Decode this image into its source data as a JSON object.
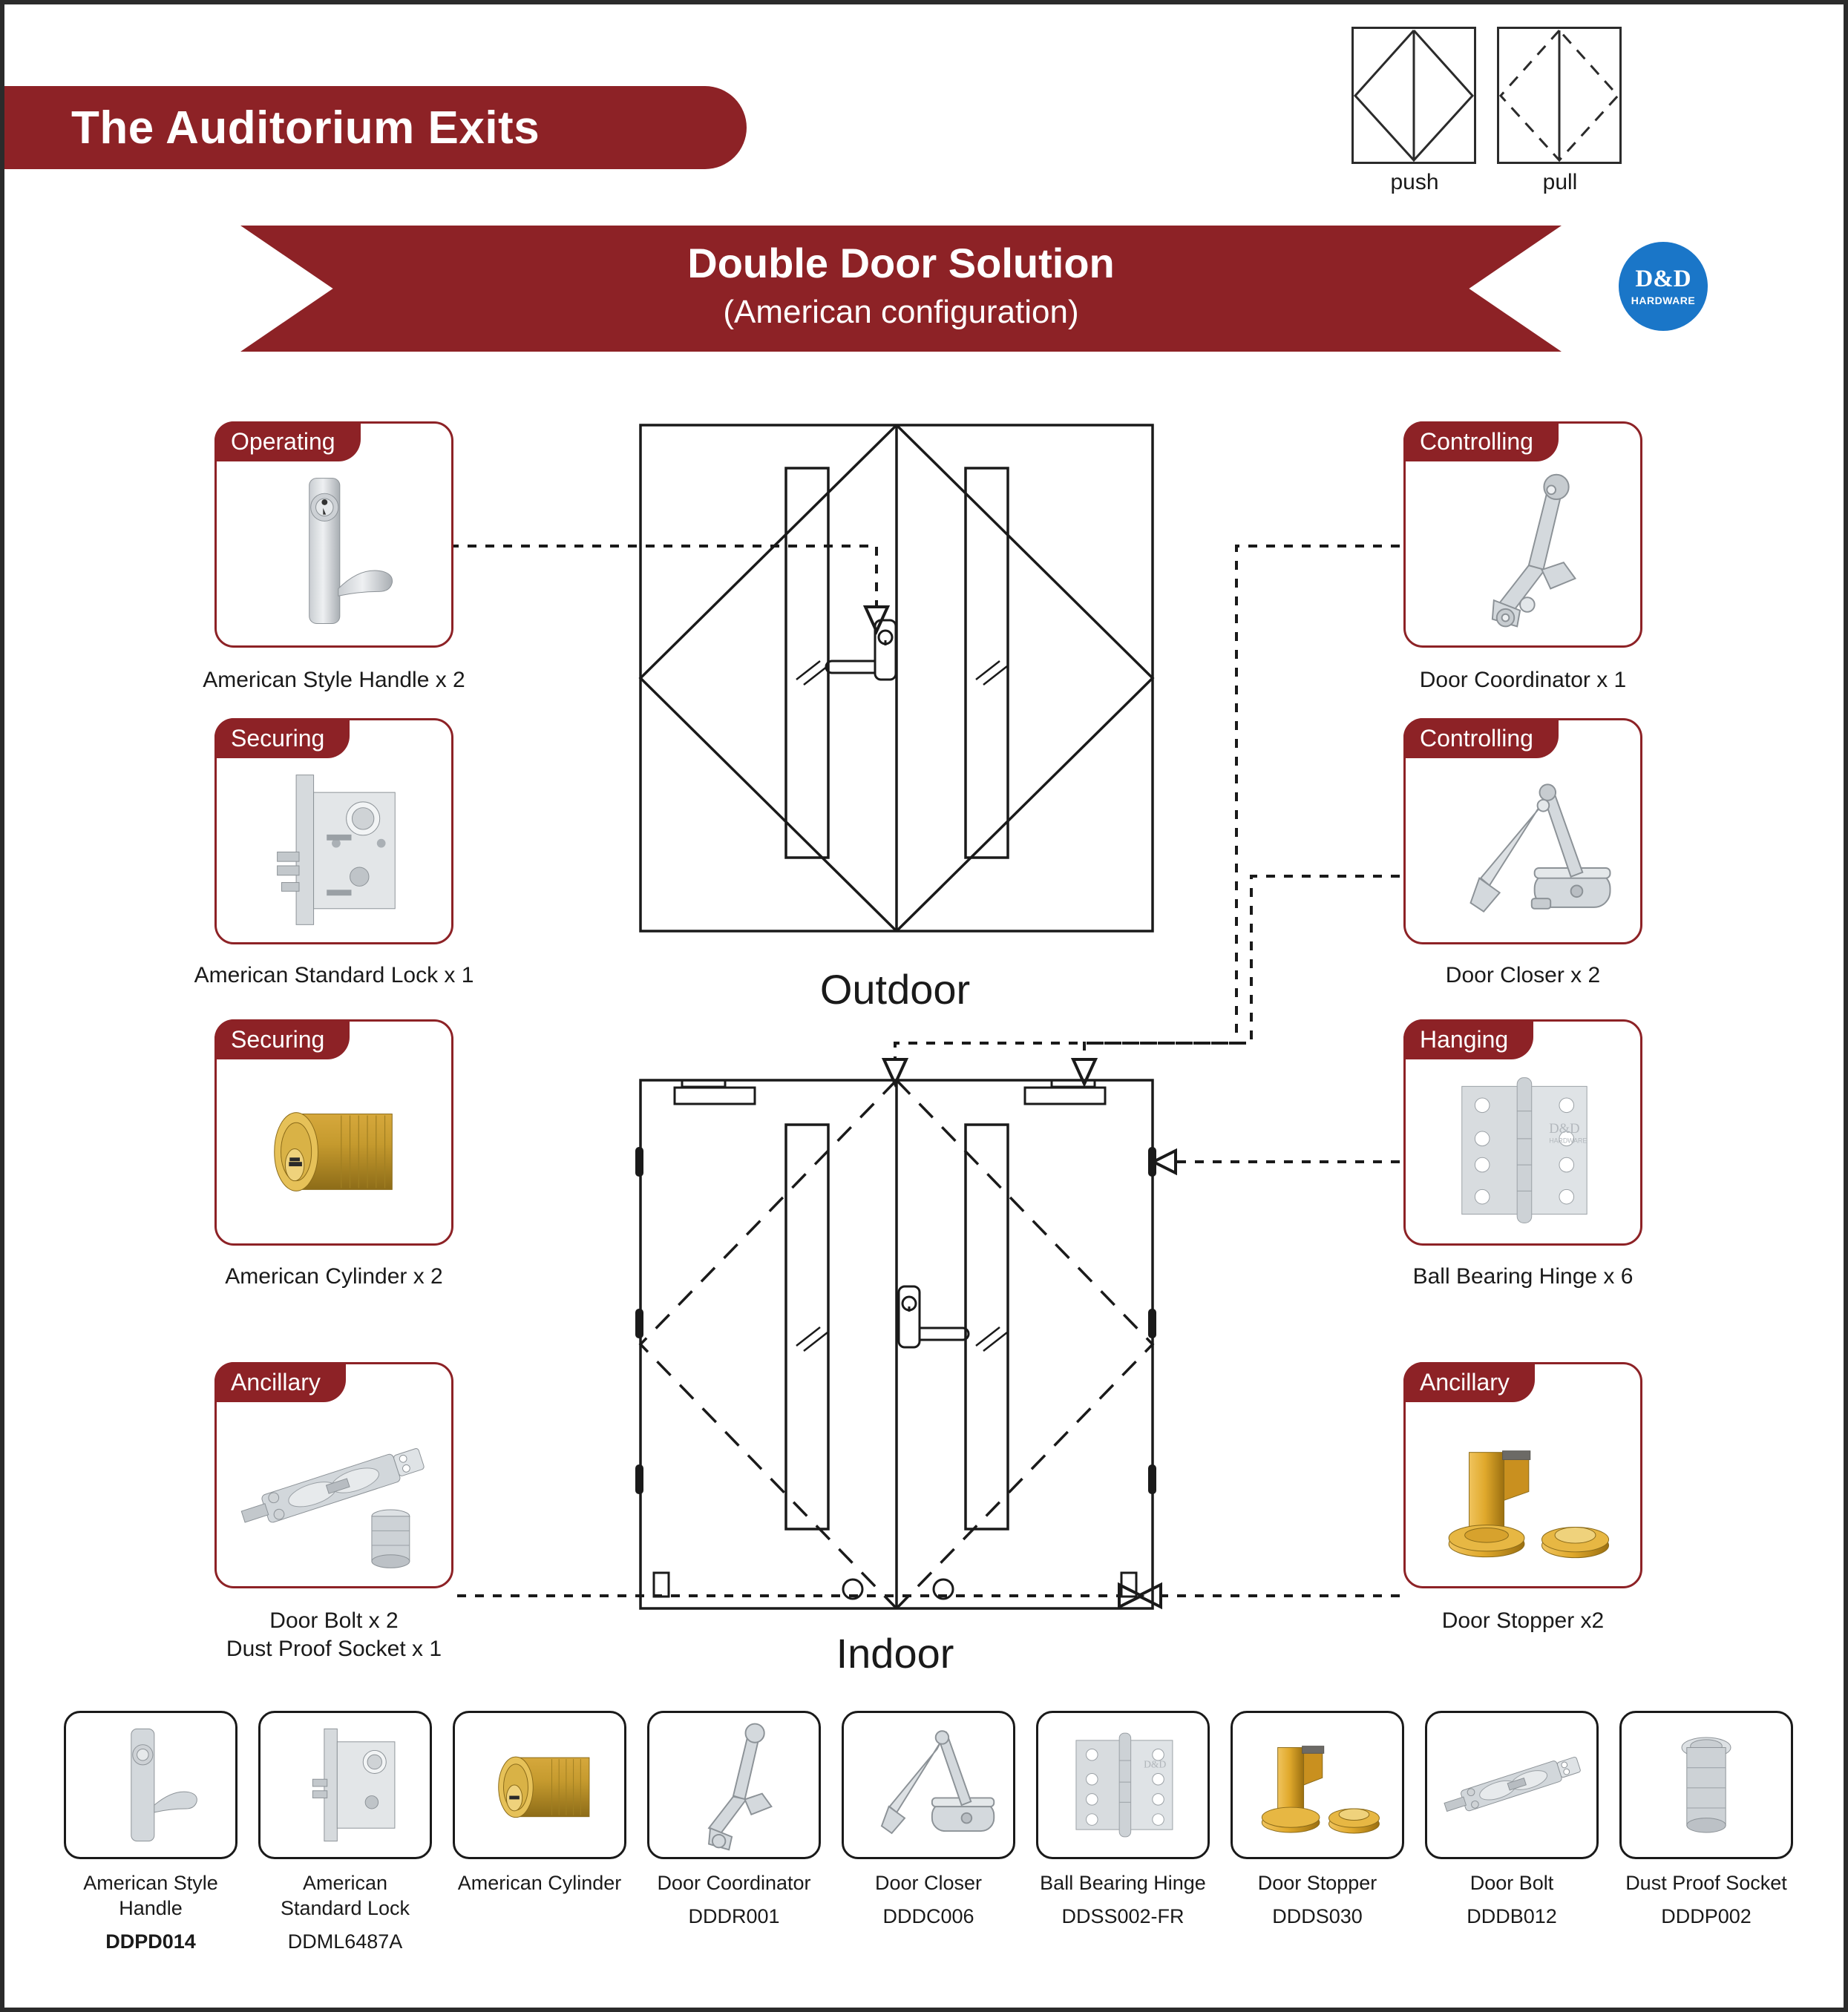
{
  "header": {
    "title": "The Auditorium Exits",
    "banner_title": "Double Door Solution",
    "banner_subtitle": "(American configuration)",
    "brand": {
      "name": "D&D",
      "sub": "HARDWARE",
      "color": "#1a76c8"
    }
  },
  "legend": {
    "push_label": "push",
    "pull_label": "pull"
  },
  "diagram": {
    "outdoor_label": "Outdoor",
    "indoor_label": "Indoor"
  },
  "colors": {
    "brand_red": "#8d2226",
    "line": "#1a1a1a",
    "brand_blue": "#1a76c8"
  },
  "left_cards": [
    {
      "tag": "Operating",
      "caption": "American Style Handle x 2",
      "icon": "handle-icon"
    },
    {
      "tag": "Securing",
      "caption": "American Standard Lock x 1",
      "icon": "mortise-lock-icon"
    },
    {
      "tag": "Securing",
      "caption": "American Cylinder x 2",
      "icon": "cylinder-icon"
    },
    {
      "tag": "Ancillary",
      "caption": "Door Bolt x 2",
      "caption2": "Dust Proof Socket x 1",
      "icon": "door-bolt-icon"
    }
  ],
  "right_cards": [
    {
      "tag": "Controlling",
      "caption": "Door Coordinator x 1",
      "icon": "door-coordinator-icon"
    },
    {
      "tag": "Controlling",
      "caption": "Door Closer x 2",
      "icon": "door-closer-icon"
    },
    {
      "tag": "Hanging",
      "caption": "Ball Bearing Hinge x 6",
      "icon": "ball-bearing-hinge-icon"
    },
    {
      "tag": "Ancillary",
      "caption": "Door Stopper x2",
      "icon": "door-stopper-icon"
    }
  ],
  "products": [
    {
      "name": "American Style Handle",
      "code": "DDPD014",
      "code_bold": true,
      "icon": "handle-icon"
    },
    {
      "name": "American\nStandard Lock",
      "code": "DDML6487A",
      "code_bold": false,
      "icon": "mortise-lock-icon"
    },
    {
      "name": "American Cylinder",
      "code": "",
      "code_bold": false,
      "icon": "cylinder-icon"
    },
    {
      "name": "Door Coordinator",
      "code": "DDDR001",
      "code_bold": false,
      "icon": "door-coordinator-icon"
    },
    {
      "name": "Door Closer",
      "code": "DDDC006",
      "code_bold": false,
      "icon": "door-closer-icon"
    },
    {
      "name": "Ball Bearing Hinge",
      "code": "DDSS002-FR",
      "code_bold": false,
      "icon": "ball-bearing-hinge-icon"
    },
    {
      "name": "Door Stopper",
      "code": "DDDS030",
      "code_bold": false,
      "icon": "door-stopper-icon"
    },
    {
      "name": "Door Bolt",
      "code": "DDDB012",
      "code_bold": false,
      "icon": "door-bolt-icon"
    },
    {
      "name": "Dust Proof Socket",
      "code": "DDDP002",
      "code_bold": false,
      "icon": "dust-proof-socket-icon"
    }
  ]
}
